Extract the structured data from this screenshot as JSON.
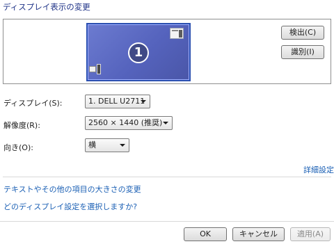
{
  "header": {
    "title": "ディスプレイ表示の変更"
  },
  "preview": {
    "monitor_number": "1",
    "detect_label": "検出(C)",
    "identify_label": "識別(I)"
  },
  "settings": {
    "display_label": "ディスプレイ(S):",
    "display_value": "1. DELL U2711",
    "resolution_label": "解像度(R):",
    "resolution_value": "2560 × 1440 (推奨)",
    "orientation_label": "向き(O):",
    "orientation_value": "横"
  },
  "links": {
    "advanced": "詳細設定",
    "text_size": "テキストやその他の項目の大きさの変更",
    "which_settings": "どのディスプレイ設定を選択しますか?"
  },
  "footer": {
    "ok_label": "OK",
    "cancel_label": "キャンセル",
    "apply_label": "適用(A)"
  }
}
